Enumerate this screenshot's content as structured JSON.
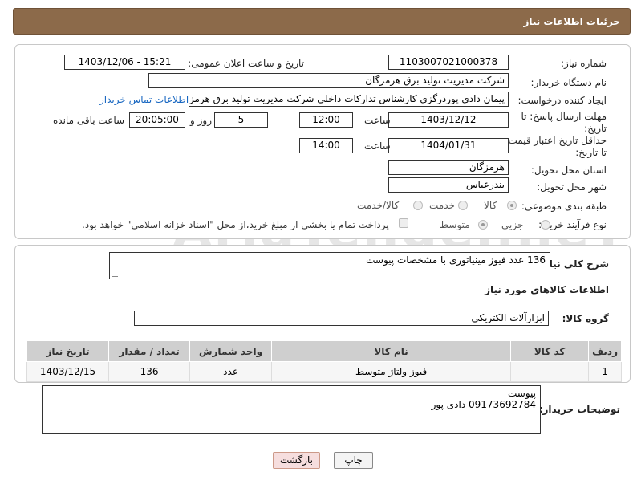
{
  "header": {
    "title": "جزئیات اطلاعات نیاز"
  },
  "fields": {
    "need_number": {
      "label": "شماره نیاز:",
      "value": "1103007021000378"
    },
    "announce_datetime": {
      "label": "تاریخ و ساعت اعلان عمومی:",
      "value": "1403/12/06 - 15:21"
    },
    "buyer_org": {
      "label": "نام دستگاه خریدار:",
      "value": "شرکت مدیریت تولید برق هرمزگان"
    },
    "requester": {
      "label": "ایجاد کننده درخواست:",
      "value": "پیمان دادی پوردرگزی کارشناس تدارکات داخلی شرکت مدیریت تولید برق هرمزگا",
      "contact_link": "اطلاعات تماس خریدار"
    },
    "reply_deadline": {
      "label": "مهلت ارسال پاسخ: تا تاریخ:",
      "date": "1403/12/12",
      "time_label": "ساعت",
      "time": "12:00",
      "days": "5",
      "days_label": "روز و",
      "remaining": "20:05:00",
      "remaining_label": "ساعت باقی مانده"
    },
    "price_validity": {
      "label": "حداقل تاریخ اعتبار قیمت: تا تاریخ:",
      "date": "1404/01/31",
      "time_label": "ساعت",
      "time": "14:00"
    },
    "province": {
      "label": "استان محل تحویل:",
      "value": "هرمزگان"
    },
    "city": {
      "label": "شهر محل تحویل:",
      "value": "بندرعباس"
    },
    "category": {
      "label": "طبقه بندی موضوعی:",
      "options": [
        "کالا",
        "خدمت",
        "کالا/خدمت"
      ],
      "selected": "کالا"
    },
    "purchase_type": {
      "label": "نوع فرآیند خرید :",
      "options": [
        "جزیی",
        "متوسط"
      ],
      "selected": "متوسط",
      "payment_note": "پرداخت تمام یا بخشی از مبلغ خرید،از محل \"اسناد خزانه اسلامی\" خواهد بود."
    }
  },
  "description": {
    "label": "شرح کلی نیاز:",
    "value": "136 عدد فیوز مینیاتوری با مشخصات پیوست"
  },
  "goods_section": {
    "title": "اطلاعات کالاهای مورد نیاز",
    "group_label": "گروه کالا:",
    "group_value": "ابزارآلات الکتریکی"
  },
  "table": {
    "headers": [
      "ردیف",
      "کد کالا",
      "نام کالا",
      "واحد شمارش",
      "تعداد / مقدار",
      "تاریخ نیاز"
    ],
    "rows": [
      [
        "1",
        "--",
        "فیوز ولتاژ متوسط",
        "عدد",
        "136",
        "1403/12/15"
      ]
    ]
  },
  "buyer_notes": {
    "label": "توضیحات خریدار:",
    "line1": "پیوست",
    "line2": "09173692784 دادی پور"
  },
  "buttons": {
    "print": "چاپ",
    "back": "بازگشت"
  },
  "watermark": "AriaTender.neT"
}
